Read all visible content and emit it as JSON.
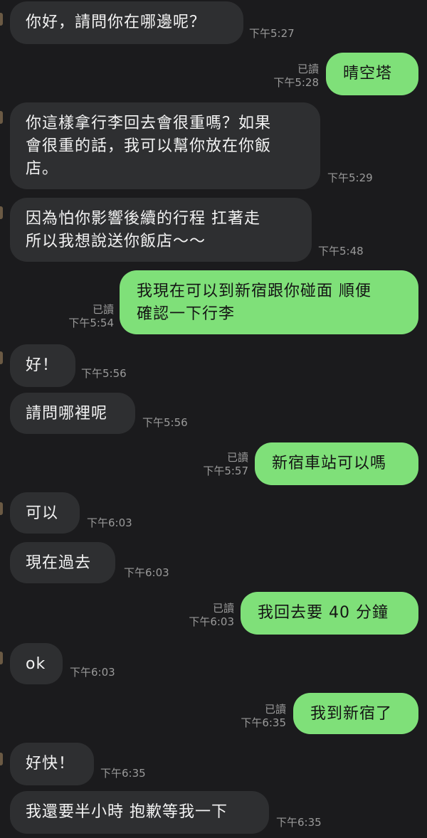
{
  "chat": {
    "messages": [
      {
        "side": "in",
        "text": "你好，請問你在哪邊呢？",
        "time": "下午5:27"
      },
      {
        "side": "out",
        "text": "晴空塔",
        "time": "下午5:28",
        "read": "已讀"
      },
      {
        "side": "in",
        "text": "你這樣拿行李回去會很重嗎？如果\n會很重的話，我可以幫你放在你飯\n店。",
        "time": "下午5:29"
      },
      {
        "side": "in",
        "text": "因為怕你影響後續的行程 扛著走\n所以我想說送你飯店～～",
        "time": "下午5:48"
      },
      {
        "side": "out",
        "text": "我現在可以到新宿跟你碰面 順便\n確認一下行李",
        "time": "下午5:54",
        "read": "已讀"
      },
      {
        "side": "in",
        "text": "好！",
        "time": "下午5:56"
      },
      {
        "side": "in",
        "text": "請問哪裡呢",
        "time": "下午5:56"
      },
      {
        "side": "out",
        "text": "新宿車站可以嗎",
        "time": "下午5:57",
        "read": "已讀"
      },
      {
        "side": "in",
        "text": "可以",
        "time": "下午6:03"
      },
      {
        "side": "in",
        "text": "現在過去",
        "time": "下午6:03"
      },
      {
        "side": "out",
        "text": "我回去要 40 分鐘",
        "time": "下午6:03",
        "read": "已讀"
      },
      {
        "side": "in",
        "text": "ok",
        "time": "下午6:03"
      },
      {
        "side": "out",
        "text": "我到新宿了",
        "time": "下午6:35",
        "read": "已讀"
      },
      {
        "side": "in",
        "text": "好快！",
        "time": "下午6:35"
      },
      {
        "side": "in",
        "text": "我還要半小時 抱歉等我一下",
        "time": "下午6:35"
      }
    ]
  },
  "colors": {
    "background": "#1b1b1d",
    "incoming_bubble": "#2e2f31",
    "outgoing_bubble": "#7fe079",
    "meta_text": "#9a9a9a"
  }
}
